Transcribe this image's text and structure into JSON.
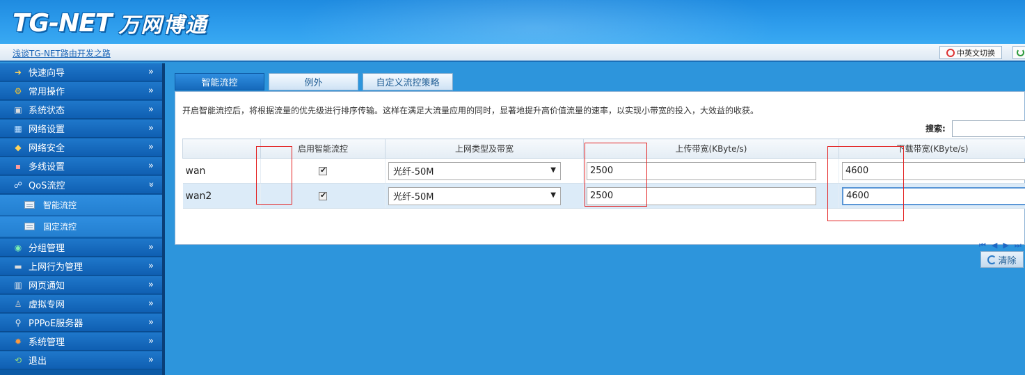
{
  "header": {
    "logo_en": "TG-NET",
    "logo_cn": "万网博通"
  },
  "topbar": {
    "link": "浅谈TG-NET路由开发之路",
    "lang_label": "中英文切换"
  },
  "sidebar": {
    "items": [
      {
        "label": "快速向导",
        "icon": "wizard-icon"
      },
      {
        "label": "常用操作",
        "icon": "common-icon"
      },
      {
        "label": "系统状态",
        "icon": "status-icon"
      },
      {
        "label": "网络设置",
        "icon": "network-icon"
      },
      {
        "label": "网络安全",
        "icon": "shield-icon"
      },
      {
        "label": "多线设置",
        "icon": "multiline-icon"
      },
      {
        "label": "QoS流控",
        "icon": "qos-icon"
      },
      {
        "label": "分组管理",
        "icon": "group-icon"
      },
      {
        "label": "上网行为管理",
        "icon": "behavior-icon"
      },
      {
        "label": "网页通知",
        "icon": "notice-icon"
      },
      {
        "label": "虚拟专网",
        "icon": "vpn-icon"
      },
      {
        "label": "PPPoE服务器",
        "icon": "pppoe-icon"
      },
      {
        "label": "系统管理",
        "icon": "gear-icon"
      },
      {
        "label": "退出",
        "icon": "exit-icon"
      }
    ],
    "arrow": "»",
    "arrow_open": "»",
    "sub_items": [
      {
        "label": "智能流控"
      },
      {
        "label": "固定流控"
      }
    ]
  },
  "tabs": [
    {
      "label": "智能流控"
    },
    {
      "label": "例外"
    },
    {
      "label": "自定义流控策略"
    }
  ],
  "panel": {
    "description": "开启智能流控后，将根据流量的优先级进行排序传输。这样在满足大流量应用的同时，显著地提升高价值流量的速率，以实现小带宽的投入，大效益的收获。",
    "search_label": "搜索:",
    "columns": [
      "",
      "启用智能流控",
      "上网类型及带宽",
      "上传带宽(KByte/s)",
      "下载带宽(KByte/s)"
    ],
    "rows": [
      {
        "name": "wan",
        "enabled": true,
        "type": "光纤-50M",
        "upload": "2500",
        "download": "4600"
      },
      {
        "name": "wan2",
        "enabled": true,
        "type": "光纤-50M",
        "upload": "2500",
        "download": "4600"
      }
    ]
  },
  "buttons": {
    "clear": "清除"
  },
  "colors": {
    "accent": "#2d95dc",
    "sidebar": "#0c5aa6",
    "highlight": "#e32020"
  }
}
